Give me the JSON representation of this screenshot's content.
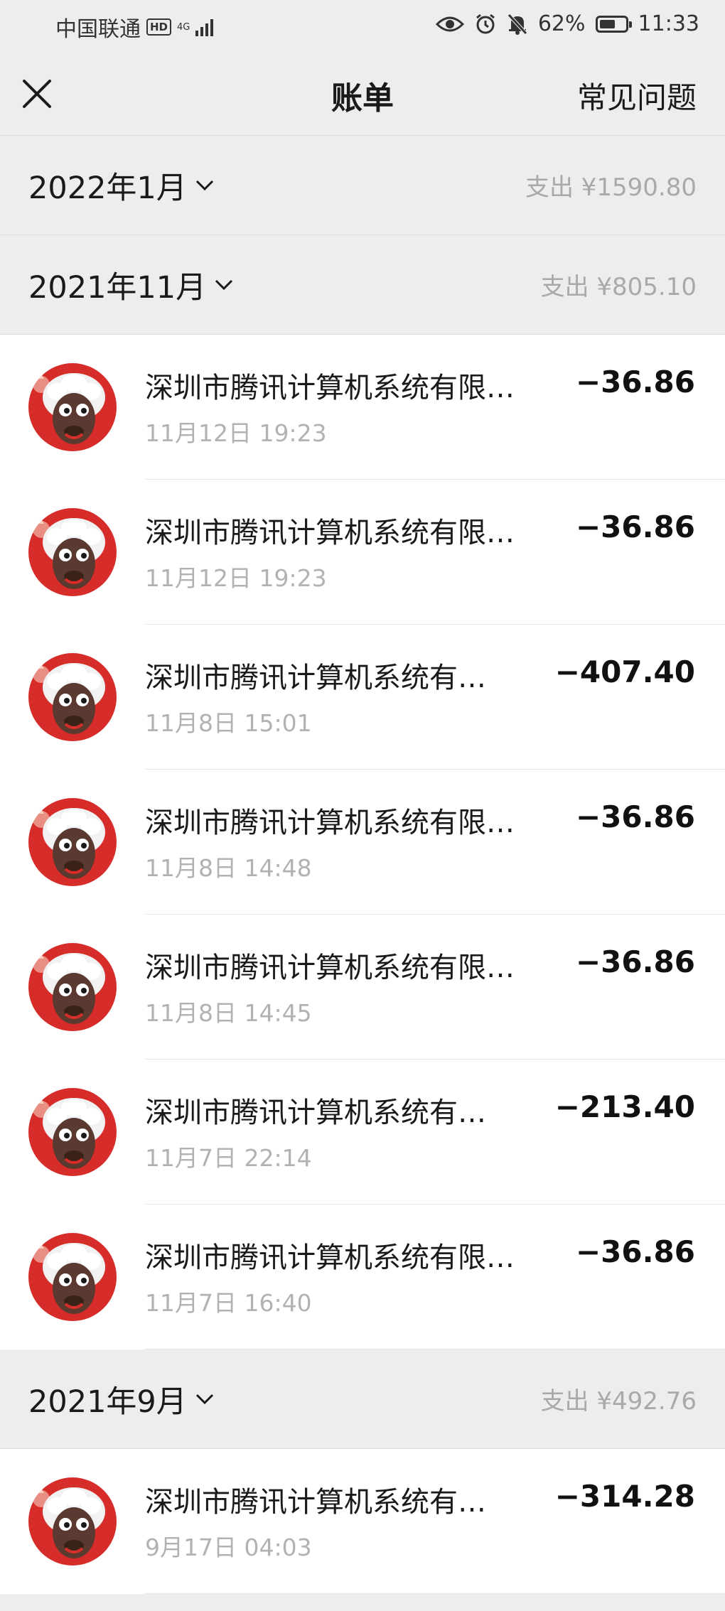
{
  "status_bar": {
    "carrier": "中国联通",
    "hd": "HD",
    "network": "4G",
    "battery": "62%",
    "battery_level": 0.62,
    "time": "11:33"
  },
  "nav": {
    "title": "账单",
    "faq": "常见问题",
    "close_icon": "close-icon"
  },
  "months": [
    {
      "label": "2022年1月",
      "total": "支出 ¥1590.80",
      "items": []
    },
    {
      "label": "2021年11月",
      "total": "支出 ¥805.10",
      "items": [
        {
          "title": "深圳市腾讯计算机系统有限…",
          "time": "11月12日 19:23",
          "amount": "−36.86"
        },
        {
          "title": "深圳市腾讯计算机系统有限…",
          "time": "11月12日 19:23",
          "amount": "−36.86"
        },
        {
          "title": "深圳市腾讯计算机系统有…",
          "time": "11月8日 15:01",
          "amount": "−407.40"
        },
        {
          "title": "深圳市腾讯计算机系统有限…",
          "time": "11月8日 14:48",
          "amount": "−36.86"
        },
        {
          "title": "深圳市腾讯计算机系统有限…",
          "time": "11月8日 14:45",
          "amount": "−36.86"
        },
        {
          "title": "深圳市腾讯计算机系统有…",
          "time": "11月7日 22:14",
          "amount": "−213.40"
        },
        {
          "title": "深圳市腾讯计算机系统有限…",
          "time": "11月7日 16:40",
          "amount": "−36.86"
        }
      ]
    },
    {
      "label": "2021年9月",
      "total": "支出 ¥492.76",
      "items": [
        {
          "title": "深圳市腾讯计算机系统有…",
          "time": "9月17日 04:03",
          "amount": "−314.28"
        }
      ]
    }
  ]
}
